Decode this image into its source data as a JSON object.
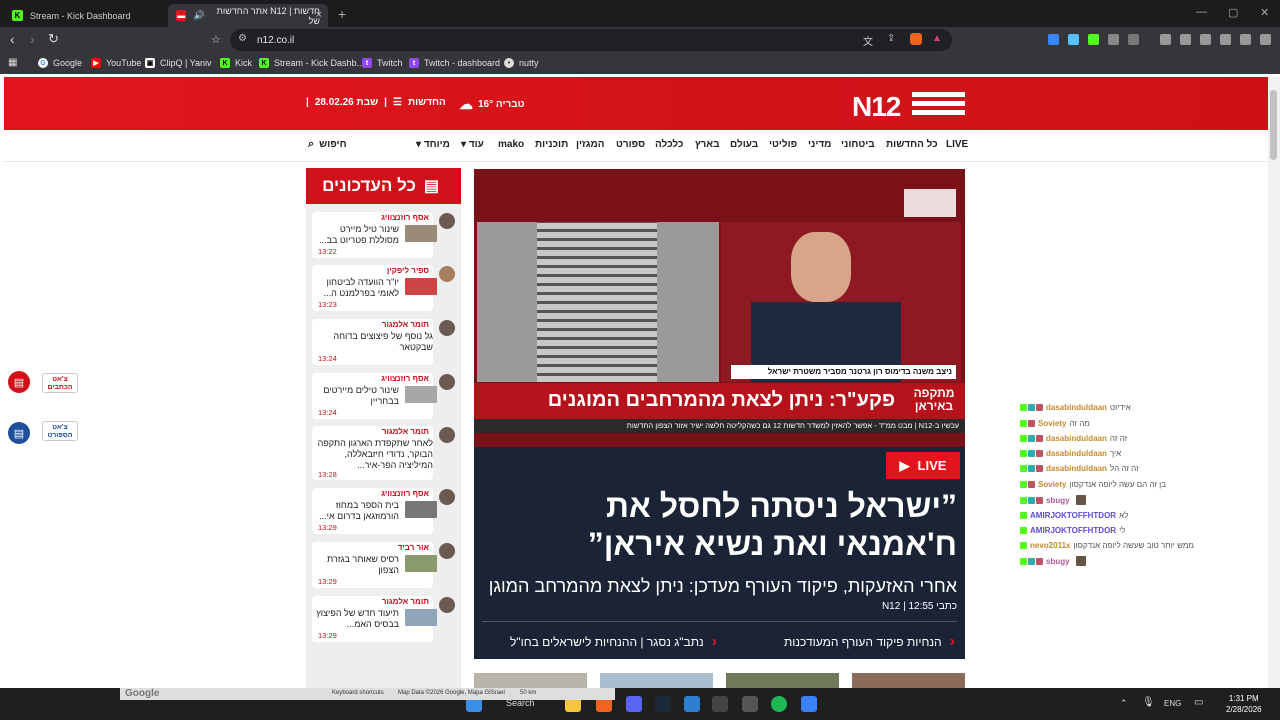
{
  "browser": {
    "tabs": [
      {
        "title": "Stream - Kick Dashboard",
        "active": false
      },
      {
        "title": "חדשות | N12 אתר החדשות של",
        "active": true
      }
    ],
    "url": "n12.co.il",
    "bookmarks": [
      "Google",
      "YouTube",
      "ClipQ | Yaniv",
      "Kick",
      "Stream - Kick Dashb...",
      "Twitch",
      "Twitch - dashboard",
      "nutty"
    ]
  },
  "site": {
    "logo": "N12",
    "brand_line": "החדשות",
    "date": "שבת 28.02.26",
    "weather": "טבריה 16°",
    "nav": [
      "LIVE",
      "כל החדשות",
      "ביטחוני",
      "מדיני",
      "פוליטי",
      "בעולם",
      "בארץ",
      "כלכלה",
      "ספורט",
      "המגזין",
      "תוכניות",
      "mako",
      "עוד",
      "מיוחד"
    ],
    "search_label": "חיפוש"
  },
  "updates": {
    "title": "כל העדכונים",
    "items": [
      {
        "author": "אסף רוזנצוויג",
        "text": "שינור טיל מיירט מסוללת פטריוט בב...",
        "time": "13:22"
      },
      {
        "author": "ספיר ליפקין",
        "text": "יו\"ר הוועדה לביטחון לאומי בפרלמנט ה...",
        "time": "13:23"
      },
      {
        "author": "תומר אלמגור",
        "text": "גל נוסף של פיצוצים בדוחה שבקטאר",
        "time": "13:24"
      },
      {
        "author": "אסף רוזנצוויג",
        "text": "שינור טילים מיירטים בבחריין",
        "time": "13:24"
      },
      {
        "author": "תומר אלמגור",
        "text": "לאחר שתקפדת הארגון התקפה הבוקר, נדודי חיזבאללה, המיליציה הפר-איר...",
        "time": "13:28"
      },
      {
        "author": "אסף רוזנצוויג",
        "text": "בית הספר במחוז הורמוזגאן בדרום אי...",
        "time": "13:29"
      },
      {
        "author": "אור רביד",
        "text": "רסיס שאותר בגזרת הצפון",
        "time": "13:29"
      },
      {
        "author": "תומר אלמגור",
        "text": "תיעוד חדש של הפיצוץ בבסיס האמ...",
        "time": "13:29"
      }
    ]
  },
  "hero": {
    "video_banner": "פקע\"ר: ניתן לצאת מהמרחבים המוגנים",
    "video_tag": "מתקפה באיראן",
    "video_caption": "ניצב משנה בדימוס   רון גרטנר מסביר משטרת ישראל",
    "video_ticker": "עכשיו ב-N12 | מבט ממ\"ד - אפשר להאזין למשדר חדשות 12 גם כשהקליטה חלשה   ישיר אזור הצפון   החדשות",
    "live_label": "LIVE",
    "headline": "”ישראל ניסתה לחסל את ח'אמנאי ואת נשיא איראן”",
    "subline": "אחרי האזעקות, פיקוד העורף מעדכן: ניתן לצאת מהמרחב המוגן",
    "byline": "כתבי N12 | 12:55",
    "related": [
      "הנחיות פיקוד העורף המעודכנות",
      "נתב\"ג נסגר | ההנחיות לישראלים בחו\"ל"
    ]
  },
  "side_widgets": [
    {
      "label": "צ'אט הכתבים",
      "color": "#d0111a"
    },
    {
      "label": "צ'אט הספורט",
      "color": "#1f4f9a"
    }
  ],
  "chat": [
    {
      "user": "dasabinduldaan",
      "msg": "אידיוט",
      "color": "#c78b2a"
    },
    {
      "user": "Soviety",
      "msg": "מה זה",
      "color": "#c78b2a"
    },
    {
      "user": "dasabinduldaan",
      "msg": "זה זה",
      "color": "#c78b2a"
    },
    {
      "user": "dasabinduldaan",
      "msg": "איך",
      "color": "#c78b2a"
    },
    {
      "user": "dasabinduldaan",
      "msg": "זה זה הל",
      "color": "#c78b2a"
    },
    {
      "user": "Soviety",
      "msg": "בן זה הם עשה ליופה אנדקסון",
      "color": "#c78b2a"
    },
    {
      "user": "sbugy",
      "msg": "",
      "color": "#b05a9a"
    },
    {
      "user": "AMIRJOKTOFFHTDOR",
      "msg": "לא",
      "color": "#5a4bd6"
    },
    {
      "user": "AMIRJOKTOFFHTDOR",
      "msg": "לי",
      "color": "#5a4bd6"
    },
    {
      "user": "nevo2011x",
      "msg": "ממש יותר טוב שעשה ליופה אנדקסון",
      "color": "#c78b2a"
    },
    {
      "user": "sbugy",
      "msg": "",
      "color": "#b05a9a"
    }
  ],
  "taskbar": {
    "search": "Search",
    "lang": "ENG",
    "time": "1:31 PM",
    "date": "2/28/2026"
  },
  "map_overlay": {
    "logo": "Google",
    "shortcuts": "Keyboard shortcuts",
    "mapdata": "Map Data ©2026 Google, Mapa GISrael",
    "scale": "50 km"
  }
}
